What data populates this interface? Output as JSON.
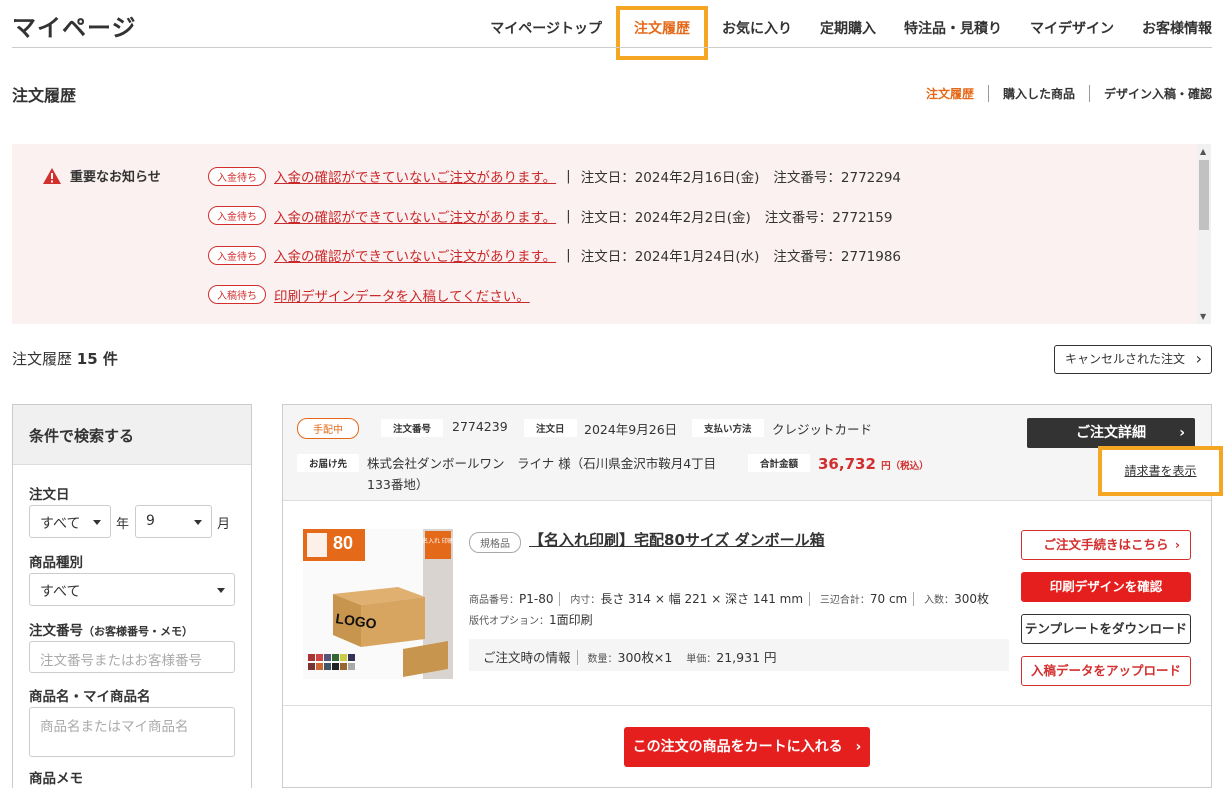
{
  "header": {
    "title": "マイページ",
    "nav": [
      "マイページトップ",
      "注文履歴",
      "お気に入り",
      "定期購入",
      "特注品・見積り",
      "マイデザイン",
      "お客様情報"
    ]
  },
  "section": {
    "title": "注文履歴",
    "subnav": [
      "注文履歴",
      "購入した商品",
      "デザイン入稿・確認"
    ]
  },
  "notice": {
    "label": "重要なお知らせ",
    "rows": [
      {
        "tag": "入金待ち",
        "link": "入金の確認ができていないご注文があります。",
        "date": "注文日：2024年2月16日(金)",
        "number": "注文番号：2772294"
      },
      {
        "tag": "入金待ち",
        "link": "入金の確認ができていないご注文があります。",
        "date": "注文日：2024年2月2日(金)",
        "number": "注文番号：2772159"
      },
      {
        "tag": "入金待ち",
        "link": "入金の確認ができていないご注文があります。",
        "date": "注文日：2024年1月24日(水)",
        "number": "注文番号：2771986"
      },
      {
        "tag": "入稿待ち",
        "link": "印刷デザインデータを入稿してください。"
      }
    ]
  },
  "count": {
    "label": "注文履歴",
    "value": "15 件"
  },
  "cancel_button": "キャンセルされた注文",
  "search": {
    "title": "条件で検索する",
    "order_date_label": "注文日",
    "year_value": "すべて",
    "year_unit": "年",
    "month_value": "9",
    "month_unit": "月",
    "type_label": "商品種別",
    "type_value": "すべて",
    "order_no_label": "注文番号",
    "order_no_sub": "（お客様番号・メモ）",
    "order_no_placeholder": "注文番号またはお客様番号",
    "name_label": "商品名・マイ商品名",
    "name_placeholder": "商品名またはマイ商品名",
    "memo_label": "商品メモ"
  },
  "order": {
    "status": "手配中",
    "order_no_label": "注文番号",
    "order_no": "2774239",
    "date_label": "注文日",
    "date": "2024年9月26日",
    "payment_label": "支払い方法",
    "payment": "クレジットカード",
    "ship_label": "お届け先",
    "ship_line1": "株式会社ダンボールワン　ライナ 様（石川県金沢市鞍月4丁目",
    "ship_line2": "133番地）",
    "total_label": "合計金額",
    "total": "36,732",
    "total_unit": "円（税込）",
    "detail_button": "ご注文詳細",
    "invoice_link": "請求書を表示",
    "product": {
      "spec_tag": "規格品",
      "title": "【名入れ印刷】宅配80サイズ ダンボール箱",
      "code_label": "商品番号：",
      "code": "P1-80",
      "inner_label": "内寸：",
      "inner": "長さ 314 × 幅 221 × 深さ 141 mm",
      "sum_label": "三辺合計：",
      "sum": "70 cm",
      "qty_label": "入数：",
      "qty": "300枚",
      "option_label": "版代オプション：",
      "option": "1面印刷",
      "info_label": "ご注文時の情報",
      "info_qty_label": "数量：",
      "info_qty": "300枚×1",
      "info_price_label": "単価：",
      "info_price": "21,931 円",
      "image": {
        "size": "80",
        "logo": "LOGO",
        "badge": "名入れ 印刷"
      }
    },
    "actions": [
      "ご注文手続きはこちら",
      "印刷デザインを確認",
      "テンプレートをダウンロード",
      "入稿データをアップロード"
    ],
    "cart_button": "この注文の商品をカートに入れる"
  },
  "colors": {
    "accent": "#e46a1a",
    "red": "#e51e1e",
    "highlight": "#f5a623",
    "notice_bg": "#fcf1f1"
  }
}
